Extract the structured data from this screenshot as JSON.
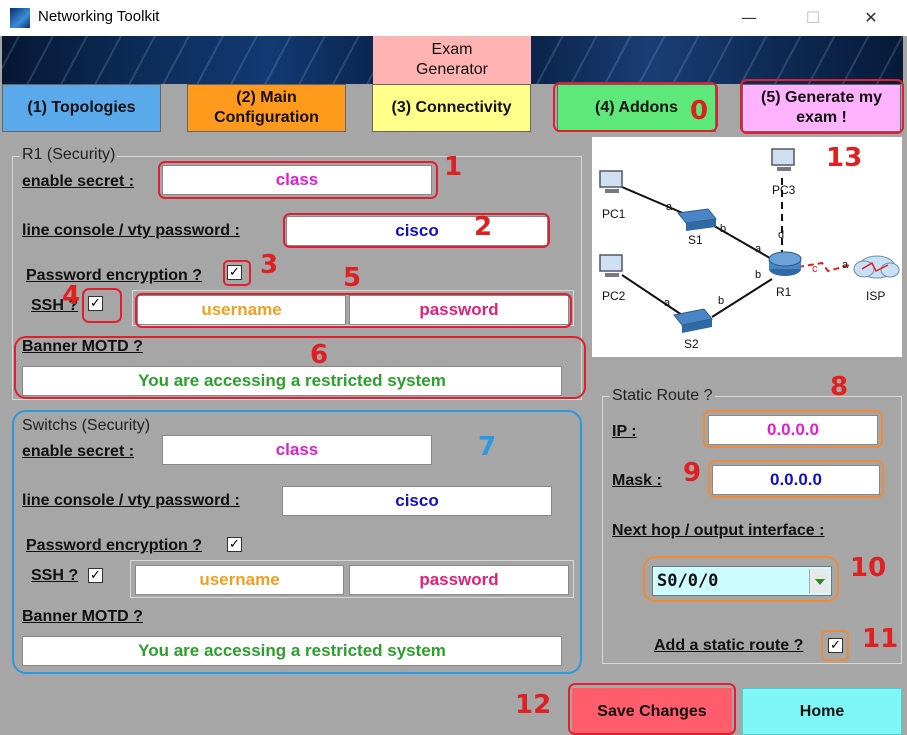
{
  "window": {
    "title": "Networking Toolkit",
    "minimize": "—",
    "maximize": "☐",
    "close": "✕"
  },
  "tabs": {
    "exam_generator": "Exam Generator",
    "topologies": "(1) Topologies",
    "main_config": "(2) Main Configuration",
    "connectivity": "(3) Connectivity",
    "addons": "(4) Addons",
    "generate_exam": "(5) Generate my exam !"
  },
  "r1": {
    "group_label": "R1 (Security)",
    "enable_secret_label": "enable secret :",
    "enable_secret_value": "class",
    "line_password_label": "line console / vty password :",
    "line_password_value": "cisco",
    "password_encryption_label": "Password encryption ?",
    "password_encryption_checked": "✓",
    "ssh_label": "SSH ?",
    "ssh_checked": "✓",
    "ssh_username": "username",
    "ssh_password": "password",
    "banner_label": "Banner MOTD ?",
    "banner_value": "You are accessing a restricted system"
  },
  "switches": {
    "group_label": "Switchs (Security)",
    "enable_secret_label": "enable secret :",
    "enable_secret_value": "class",
    "line_password_label": "line console / vty password :",
    "line_password_value": "cisco",
    "password_encryption_label": "Password encryption ?",
    "password_encryption_checked": "✓",
    "ssh_label": "SSH ?",
    "ssh_checked": "✓",
    "ssh_username": "username",
    "ssh_password": "password",
    "banner_label": "Banner MOTD ?",
    "banner_value": "You are accessing a restricted system"
  },
  "topology": {
    "devices": [
      "PC1",
      "PC2",
      "PC3",
      "S1",
      "S2",
      "R1",
      "ISP"
    ],
    "links": [
      "a",
      "b",
      "a",
      "b",
      "a",
      "b",
      "c",
      "a",
      "d"
    ]
  },
  "static_route": {
    "group_label": "Static Route ?",
    "ip_label": "IP :",
    "ip_value": "0.0.0.0",
    "mask_label": "Mask :",
    "mask_value": "0.0.0.0",
    "next_hop_label": "Next hop / output interface :",
    "interface_value": "S0/0/0",
    "add_route_label": "Add a static route ?",
    "add_route_checked": "✓"
  },
  "buttons": {
    "save": "Save Changes",
    "home": "Home"
  },
  "annotations": [
    "0",
    "1",
    "2",
    "3",
    "4",
    "5",
    "6",
    "7",
    "8",
    "9",
    "10",
    "11",
    "12",
    "13"
  ],
  "colors": {
    "background": "#a6a6a6",
    "annotation_red": "#e02020",
    "annotation_blue": "#2b98e0",
    "annotation_orange": "#ee8a3a"
  }
}
